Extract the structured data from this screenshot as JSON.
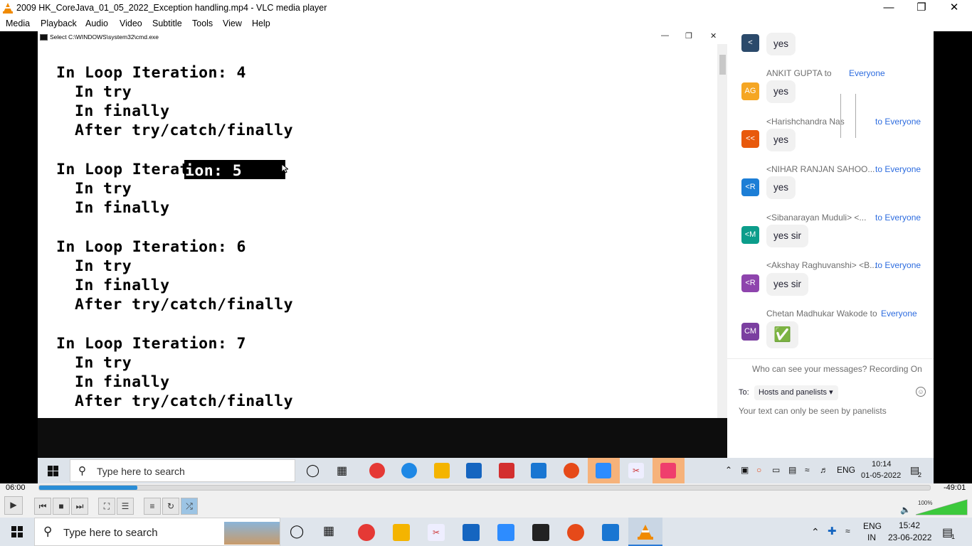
{
  "vlc": {
    "title": "2009 HK_CoreJava_01_05_2022_Exception handling.mp4 - VLC media player",
    "menu": [
      "Media",
      "Playback",
      "Audio",
      "Video",
      "Subtitle",
      "Tools",
      "View",
      "Help"
    ],
    "elapsed": "06:00",
    "remaining": "-49:01",
    "progress_fraction": 0.11,
    "volume_label": "100%",
    "volume_fraction": 1.0
  },
  "cmd": {
    "title": "Select C:\\WINDOWS\\system32\\cmd.exe",
    "lines": [
      {
        "text": "In Loop Iteration: 4",
        "indent": false
      },
      {
        "text": "In try",
        "indent": true
      },
      {
        "text": "In finally",
        "indent": true
      },
      {
        "text": "After try/catch/finally",
        "indent": true
      },
      {
        "text": "In Loop Iterat",
        "indent": false
      },
      {
        "text": "In try",
        "indent": true
      },
      {
        "text": "In finally",
        "indent": true
      },
      {
        "text": "In Loop Iteration: 6",
        "indent": false
      },
      {
        "text": "In try",
        "indent": true
      },
      {
        "text": "In finally",
        "indent": true
      },
      {
        "text": "After try/catch/finally",
        "indent": true
      },
      {
        "text": "In Loop Iteration: 7",
        "indent": false
      },
      {
        "text": "In try",
        "indent": true
      },
      {
        "text": "In finally",
        "indent": true
      },
      {
        "text": "After try/catch/finally",
        "indent": true
      }
    ],
    "selected_text": "ion: 5"
  },
  "chat": {
    "messages": [
      {
        "sender": "",
        "to": "",
        "avatar": "<",
        "avatar_color": "#2b4a6b",
        "text": "yes"
      },
      {
        "sender": "ANKIT GUPTA to",
        "to": "Everyone",
        "avatar": "AG",
        "avatar_color": "#f5a623",
        "text": "yes"
      },
      {
        "sender": "<Harishchandra      Nas",
        "to": "to Everyone",
        "avatar": "<<",
        "avatar_color": "#e8590c",
        "text": "yes"
      },
      {
        "sender": "<NIHAR RANJAN SAHOO...",
        "to": "to Everyone",
        "avatar": "<R",
        "avatar_color": "#1c7ed6",
        "text": "yes"
      },
      {
        "sender": "<Sibanarayan Muduli> <...",
        "to": "to Everyone",
        "avatar": "<M",
        "avatar_color": "#0c9d8b",
        "text": "yes sir"
      },
      {
        "sender": "<Akshay Raghuvanshi> <B...",
        "to": "to Everyone",
        "avatar": "<R",
        "avatar_color": "#8e44ad",
        "text": "yes sir"
      },
      {
        "sender": "Chetan Madhukar Wakode to",
        "to": "Everyone",
        "avatar": "CM",
        "avatar_color": "#7b3fa0",
        "text": "✅"
      }
    ],
    "who_can_see": "Who can see your messages? Recording On",
    "to_label": "To:",
    "to_value": "Hosts and panelists",
    "hint": "Your text can only be seen by panelists"
  },
  "taskbar_inner": {
    "search_placeholder": "Type here to search",
    "lang": "ENG",
    "time": "10:14",
    "date": "01-05-2022",
    "notif_count": "2"
  },
  "taskbar_outer": {
    "search_placeholder": "Type here to search",
    "lang": "ENG",
    "region": "IN",
    "time": "15:42",
    "date": "23-06-2022",
    "notif_count": "1"
  }
}
